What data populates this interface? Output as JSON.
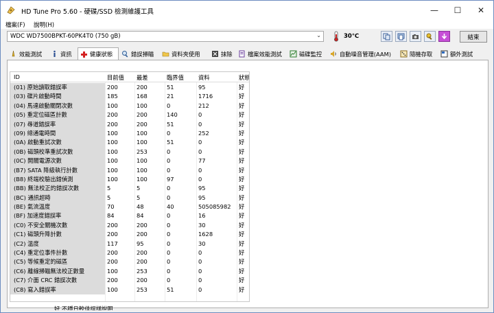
{
  "window": {
    "title": "HD Tune Pro 5.60 - 硬碟/SSD 檢測維護工具",
    "minimize_glyph": "—",
    "maximize_glyph": "☐",
    "close_glyph": "✕"
  },
  "menu": {
    "file": "檔案(F)",
    "help": "說明(H)"
  },
  "toolbar": {
    "drive": "WDC WD7500BPKT-60PK4T0 (750 gB)",
    "temperature": "30℃",
    "exit_label": "結束",
    "icons": [
      "copy-info-icon",
      "copy-screen-icon",
      "screenshot-camera-icon",
      "settings-wrench-icon",
      "download-arrow-icon"
    ]
  },
  "tabs": [
    {
      "label": "效能測試",
      "icon": "benchmark-icon"
    },
    {
      "label": "資訊",
      "icon": "info-icon"
    },
    {
      "label": "健康狀態",
      "icon": "health-cross-icon",
      "active": true
    },
    {
      "label": "錯誤掃瞄",
      "icon": "error-scan-icon"
    },
    {
      "label": "資料夾使用",
      "icon": "folder-usage-icon"
    },
    {
      "label": "抹除",
      "icon": "erase-icon"
    },
    {
      "label": "檔案效能測試",
      "icon": "file-benchmark-icon"
    },
    {
      "label": "磁碟監控",
      "icon": "disk-monitor-icon"
    },
    {
      "label": "自動噪音管理(AAM)",
      "icon": "speaker-icon"
    },
    {
      "label": "隨機存取",
      "icon": "random-access-icon"
    },
    {
      "label": "額外測試",
      "icon": "extra-tests-icon"
    }
  ],
  "smart_table": {
    "headers": [
      "ID",
      "目前值",
      "最差",
      "臨界值",
      "資料",
      "狀態"
    ],
    "rows": [
      [
        "(01) 原始讀取錯誤率",
        "200",
        "200",
        "51",
        "95",
        "好"
      ],
      [
        "(03) 碟片啟動時間",
        "185",
        "168",
        "21",
        "1716",
        "好"
      ],
      [
        "(04) 馬達啟動關閉次數",
        "100",
        "100",
        "0",
        "212",
        "好"
      ],
      [
        "(05) 重定位磁區計數",
        "200",
        "200",
        "140",
        "0",
        "好"
      ],
      [
        "(07) 尋道錯誤率",
        "200",
        "200",
        "51",
        "0",
        "好"
      ],
      [
        "(09) 總通電時間",
        "100",
        "100",
        "0",
        "252",
        "好"
      ],
      [
        "(0A) 啟動重試次數",
        "100",
        "100",
        "51",
        "0",
        "好"
      ],
      [
        "(0B) 磁頭校準重試次數",
        "100",
        "253",
        "0",
        "0",
        "好"
      ],
      [
        "(0C) 開關電源次數",
        "100",
        "100",
        "0",
        "77",
        "好"
      ],
      [
        "(B7) SATA 降級執行計數",
        "100",
        "100",
        "0",
        "0",
        "好"
      ],
      [
        "(B8) 終端校驗出錯偵測",
        "100",
        "100",
        "97",
        "0",
        "好"
      ],
      [
        "(BB) 無法校正的錯誤次數",
        "5",
        "5",
        "0",
        "95",
        "好"
      ],
      [
        "(BC) 通訊超時",
        "5",
        "5",
        "0",
        "95",
        "好"
      ],
      [
        "(BE) 氣流溫度",
        "70",
        "48",
        "40",
        "505085982",
        "好"
      ],
      [
        "(BF) 加速度錯誤率",
        "84",
        "84",
        "0",
        "16",
        "好"
      ],
      [
        "(C0) 不安全關機次數",
        "200",
        "200",
        "0",
        "30",
        "好"
      ],
      [
        "(C1) 磁頭升降計數",
        "200",
        "200",
        "0",
        "1628",
        "好"
      ],
      [
        "(C2) 溫度",
        "117",
        "95",
        "0",
        "30",
        "好"
      ],
      [
        "(C4) 重定位事件計數",
        "200",
        "200",
        "0",
        "0",
        "好"
      ],
      [
        "(C5) 等候重定的磁區",
        "200",
        "200",
        "0",
        "0",
        "好"
      ],
      [
        "(C6) 離線掃瞄無法校正數量",
        "100",
        "253",
        "0",
        "0",
        "好"
      ],
      [
        "(C7) 介面 CRC 錯誤次數",
        "200",
        "200",
        "0",
        "0",
        "好"
      ],
      [
        "(C8) 寫入錯誤率",
        "100",
        "253",
        "51",
        "0",
        "好"
      ]
    ]
  },
  "footer_text": "好   不穩日較佳誤詳說明"
}
